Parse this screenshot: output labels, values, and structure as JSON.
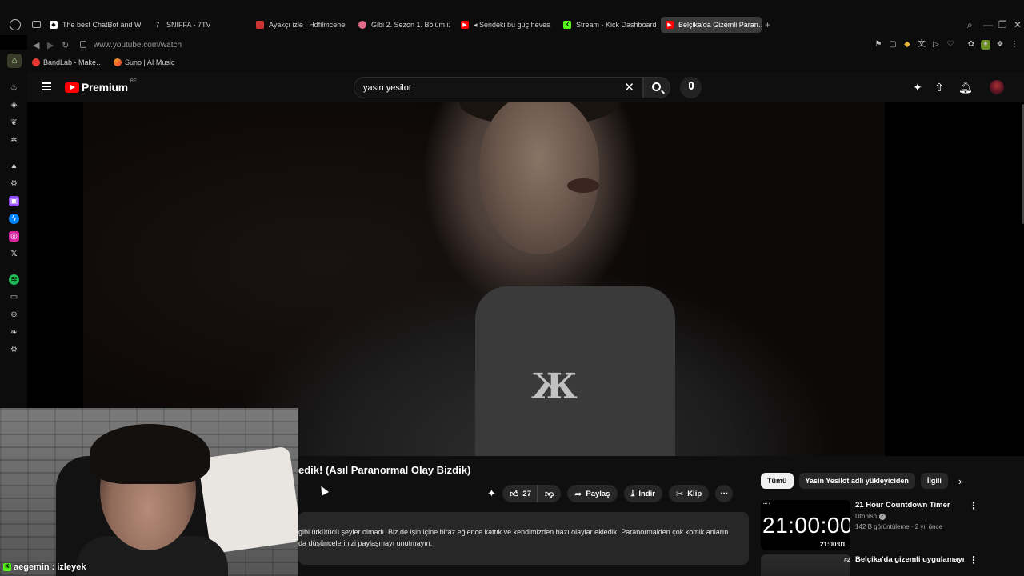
{
  "browser": {
    "tabs": [
      {
        "label": "The best ChatBot and W…",
        "fav_color": "#ffffff"
      },
      {
        "label": "SNIFFA - 7TV",
        "fav_color": "#dddddd"
      },
      {
        "label": "Ayakçı izle | Hdfilmcehen…",
        "fav_color": "#cc3333"
      },
      {
        "label": "Gibi 2. Sezon 1. Bölüm iz…",
        "fav_color": "#e06a8a"
      },
      {
        "label": "◂ Sendeki bu güç heves…",
        "fav_color": "#ff0000"
      },
      {
        "label": "Stream - Kick Dashboard",
        "fav_color": "#53fc18"
      },
      {
        "label": "Belçika'da Gizemli Paran…",
        "fav_color": "#ff0000"
      }
    ],
    "new_tab": "+",
    "url": "www.youtube.com/watch",
    "bookmarks": [
      {
        "label": "BandLab - Make…",
        "color": "#e53935"
      },
      {
        "label": "Suno | AI Music",
        "color": "#f5a623"
      }
    ]
  },
  "youtube": {
    "logo_word": "Premium",
    "country_code": "BE",
    "search_query": "yasin yesilot",
    "video_title": "edik! (Asıl Paranormal Olay Bizdik)",
    "actions": {
      "like_count": "27",
      "share": "Paylaş",
      "download": "İndir",
      "clip": "Klip"
    },
    "description_line1": "gibi ürkütücü şeyler olmadı. Biz de işin içine biraz eğlence kattık ve kendimizden bazı olaylar ekledik. Paranormalden çok komik anların",
    "description_line2": "da düşüncelerinizi paylaşmayı unutmayın.",
    "chips": [
      "Tümü",
      "Yasin Yesilot adlı yükleyiciden",
      "İlgili"
    ],
    "recommendations": [
      {
        "title": "21 Hour Countdown Timer",
        "channel": "Utonish",
        "meta": "142 B görüntüleme · 2 yıl önce",
        "thumb_text": "21:00:00",
        "duration": "21:00:01"
      },
      {
        "title": "Belçika'da gizemli uygulamayı",
        "rank": "#2"
      }
    ]
  },
  "webcam": {
    "name": "aegemin",
    "status": ": izleyek"
  }
}
